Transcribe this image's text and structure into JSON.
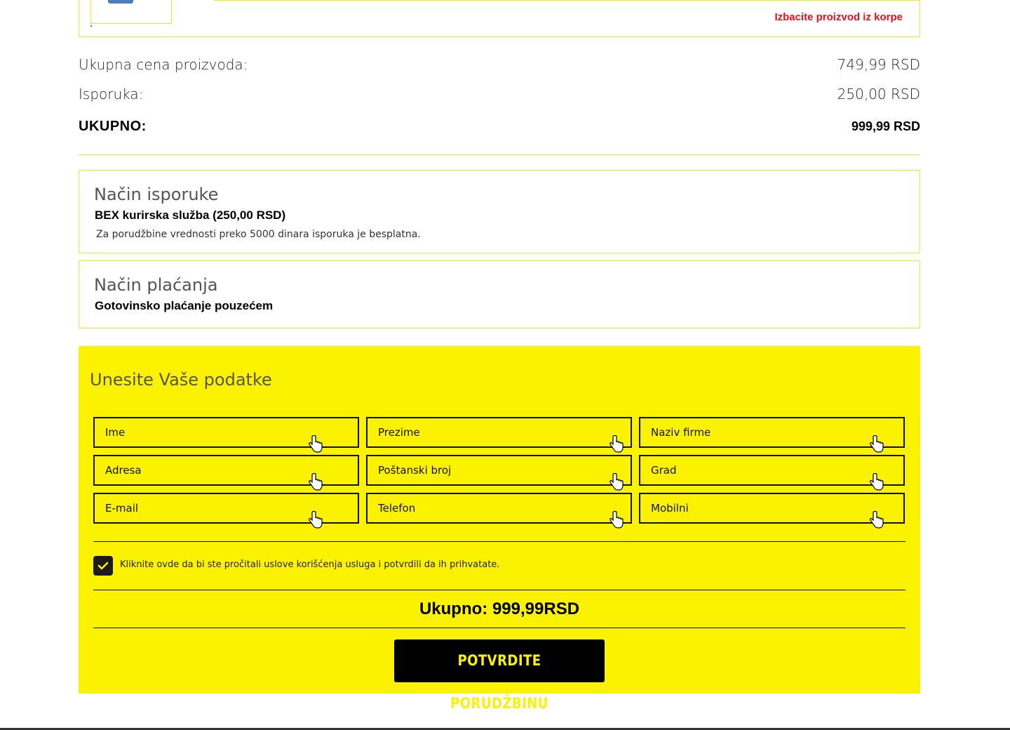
{
  "cart": {
    "remove_label": "Izbacite proizvod iz korpe"
  },
  "summary": {
    "products_label": "Ukupna cena proizvoda:",
    "products_value": "749,99 RSD",
    "shipping_label": "Isporuka:",
    "shipping_value": "250,00 RSD",
    "total_label": "UKUPNO:",
    "total_value": "999,99 RSD"
  },
  "delivery": {
    "title": "Način isporuke",
    "method": "BEX kurirska služba (250,00 RSD)",
    "note": "Za porudžbine vrednosti preko 5000 dinara isporuka je besplatna."
  },
  "payment": {
    "title": "Način plaćanja",
    "method": "Gotovinsko plaćanje pouzećem"
  },
  "form": {
    "title": "Unesite Vaše podatke",
    "fields": {
      "first_name": "Ime",
      "last_name": "Prezime",
      "company": "Naziv firme",
      "address": "Adresa",
      "postal_code": "Poštanski broj",
      "city": "Grad",
      "email": "E-mail",
      "phone": "Telefon",
      "mobile": "Mobilni"
    },
    "terms_checked": true,
    "terms_label": "Kliknite ovde da bi ste pročitali uslove korišćenja usluga i potvrdili da ih prihvatate.",
    "total_label": "Ukupno:",
    "total_value": "999,99RSD",
    "confirm_label": "POTVRDITE PORUDŽBINU"
  },
  "colors": {
    "accent_yellow": "#fbf200",
    "border_yellow": "#f0e92a",
    "remove_red": "#e8101c",
    "dark": "#000000"
  }
}
